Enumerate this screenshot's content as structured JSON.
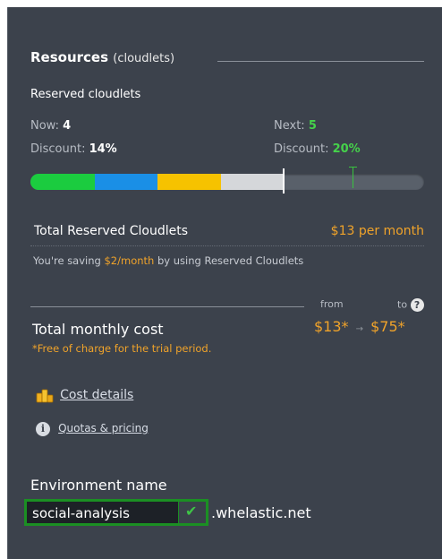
{
  "resources": {
    "title": "Resources",
    "unit": "(cloudlets)",
    "reserved_heading": "Reserved cloudlets",
    "now_label": "Now:",
    "now_value": "4",
    "next_label": "Next:",
    "next_value": "5",
    "discount_label": "Discount:",
    "now_discount": "14%",
    "next_discount": "20%",
    "bar": {
      "segments": [
        {
          "color": "#1bcc3f",
          "share": 0.163
        },
        {
          "color": "#1a8fe6",
          "share": 0.16
        },
        {
          "color": "#f6c200",
          "share": 0.16
        },
        {
          "color": "#d5d7da",
          "share": 0.16
        }
      ],
      "now_level": 0.643,
      "next_level": 0.818
    }
  },
  "total_reserved": {
    "label": "Total Reserved Cloudlets",
    "price": "$13 per month",
    "saving_prefix": "You're saving ",
    "saving_amount": "$2/month",
    "saving_suffix": " by using Reserved Cloudlets"
  },
  "monthly": {
    "from_label": "from",
    "to_label": "to",
    "label": "Total monthly cost",
    "from_value": "$13*",
    "arrow": "→",
    "to_value": "$75*",
    "note": "*Free of charge for the trial period."
  },
  "links": {
    "cost_details": "Cost details",
    "quotas_pricing": "Quotas & pricing"
  },
  "environment": {
    "label": "Environment name",
    "value": "social-analysis",
    "suffix": ".whelastic.net"
  },
  "icons": {
    "help": "?",
    "info": "i",
    "check": "✔"
  }
}
